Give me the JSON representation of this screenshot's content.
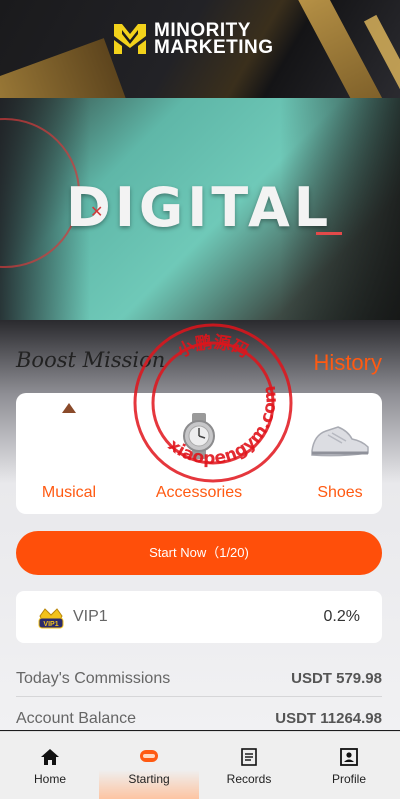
{
  "brand": {
    "line1": "MINORITY",
    "line2": "MARKETING",
    "accent": "#f2d21b"
  },
  "banner": {
    "word": "DIGITAL"
  },
  "section": {
    "title": "Boost Mission",
    "history": "History"
  },
  "categories": [
    {
      "label": "Musical",
      "icon": "musical-product-icon"
    },
    {
      "label": "Accessories",
      "icon": "watch-icon"
    },
    {
      "label": "Shoes",
      "icon": "sneaker-icon"
    }
  ],
  "start": {
    "label": "Start Now（1/20)"
  },
  "vip": {
    "level": "VIP1",
    "rate": "0.2%",
    "badge_text": "VIP1"
  },
  "stats": [
    {
      "label": "Today's Commissions",
      "value": "USDT 579.98"
    },
    {
      "label": "Account Balance",
      "value": "USDT 11264.98"
    }
  ],
  "nav": [
    {
      "label": "Home",
      "icon": "home-icon"
    },
    {
      "label": "Starting",
      "icon": "starting-icon"
    },
    {
      "label": "Records",
      "icon": "records-icon"
    },
    {
      "label": "Profile",
      "icon": "profile-icon"
    }
  ],
  "watermark": {
    "top": "小鹏源码",
    "ring": "xiaopengym.com"
  },
  "colors": {
    "accent": "#ff4f0a",
    "text_orange": "#ff5a12"
  }
}
